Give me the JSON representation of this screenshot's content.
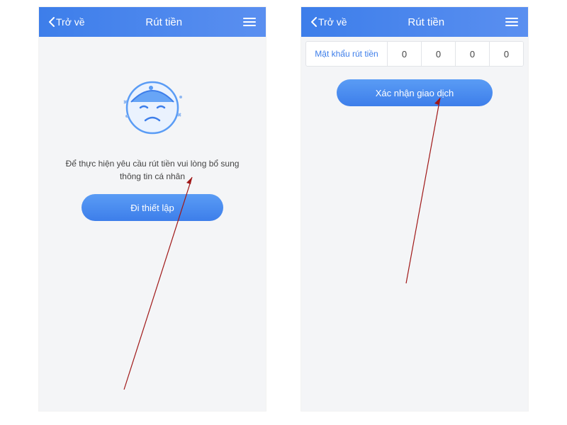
{
  "screen1": {
    "back_label": "Trở về",
    "title": "Rút tiền",
    "message": "Để thực hiện yêu cầu rút tiền vui lòng bổ sung thông tin cá nhân",
    "button_label": "Đi thiết lập"
  },
  "screen2": {
    "back_label": "Trở về",
    "title": "Rút tiền",
    "pw_label": "Mật khẩu rút tiền",
    "pw_values": [
      "0",
      "0",
      "0",
      "0"
    ],
    "button_label": "Xác nhận giao dịch"
  }
}
